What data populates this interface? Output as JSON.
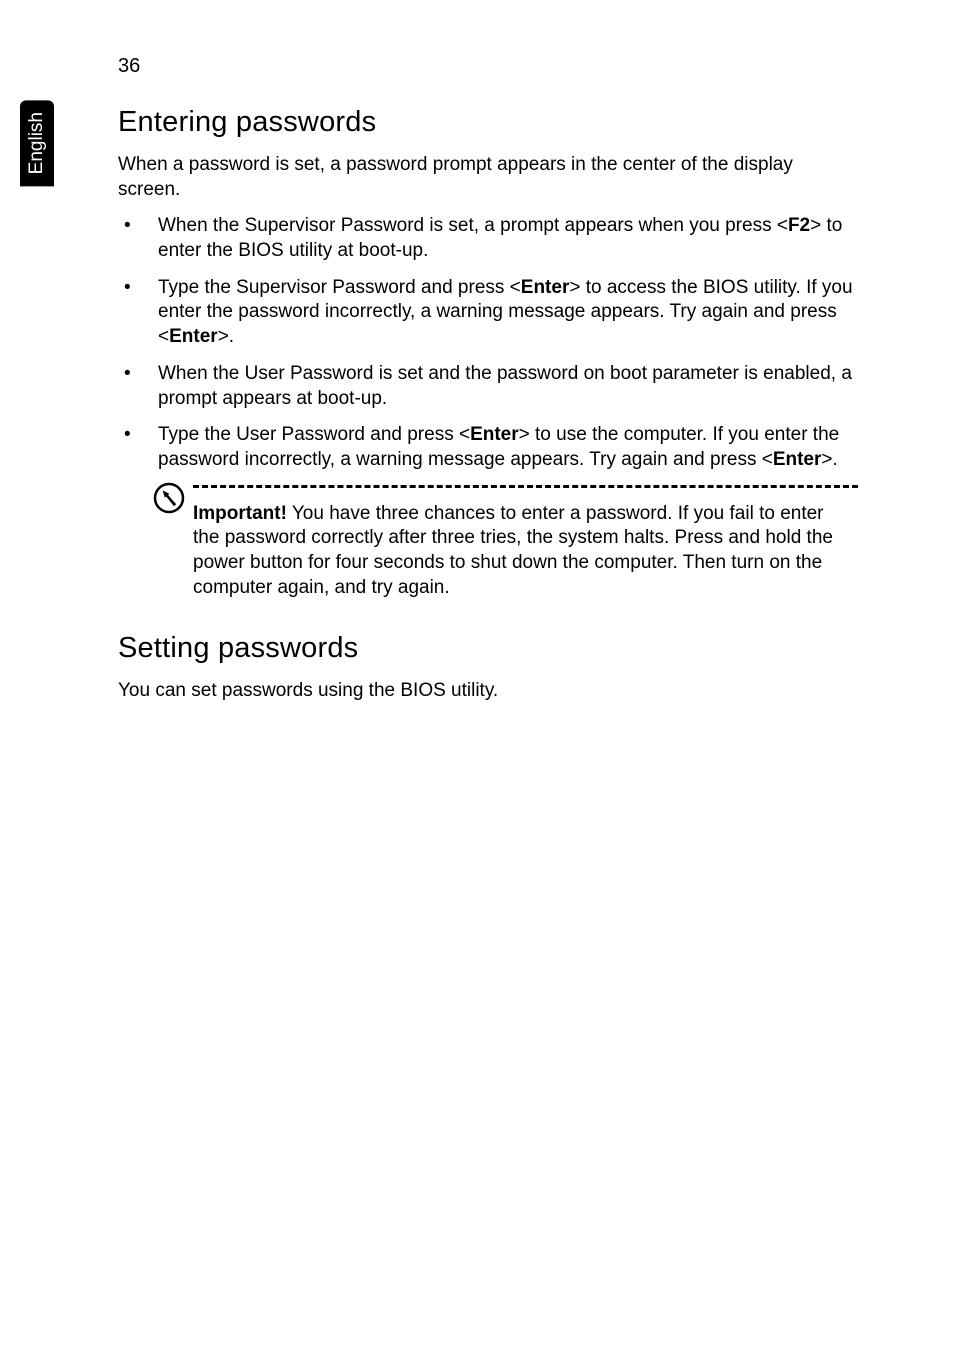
{
  "sideTab": "English",
  "pageNumber": "36",
  "section1": {
    "heading": "Entering passwords",
    "intro": "When a password is set, a password prompt appears in the center of the display screen.",
    "bullets": {
      "b1": {
        "pre": "When the Supervisor Password is set, a prompt appears when you press <",
        "key": "F2",
        "post": "> to enter the BIOS utility at boot-up."
      },
      "b2": {
        "pre": "Type the Supervisor Password and press <",
        "key1": "Enter",
        "mid": "> to access the BIOS utility. If you enter the password incorrectly, a warning message appears. Try again and press <",
        "key2": "Enter",
        "post": ">."
      },
      "b3": {
        "text": "When the User Password is set and the password on boot parameter is enabled, a prompt appears at boot-up."
      },
      "b4": {
        "pre": "Type the User Password and press <",
        "key1": "Enter",
        "mid": "> to use the computer. If you enter the password incorrectly, a warning message appears. Try again and press <",
        "key2": "Enter",
        "post": ">."
      }
    },
    "note": {
      "label": "Important!",
      "text": " You have three chances to enter a password. If you fail to enter the password correctly after three tries, the system halts. Press and hold the power button for four seconds to shut down the computer. Then turn on the computer again, and try again."
    }
  },
  "section2": {
    "heading": "Setting passwords",
    "intro": "You can set passwords using the BIOS utility."
  }
}
